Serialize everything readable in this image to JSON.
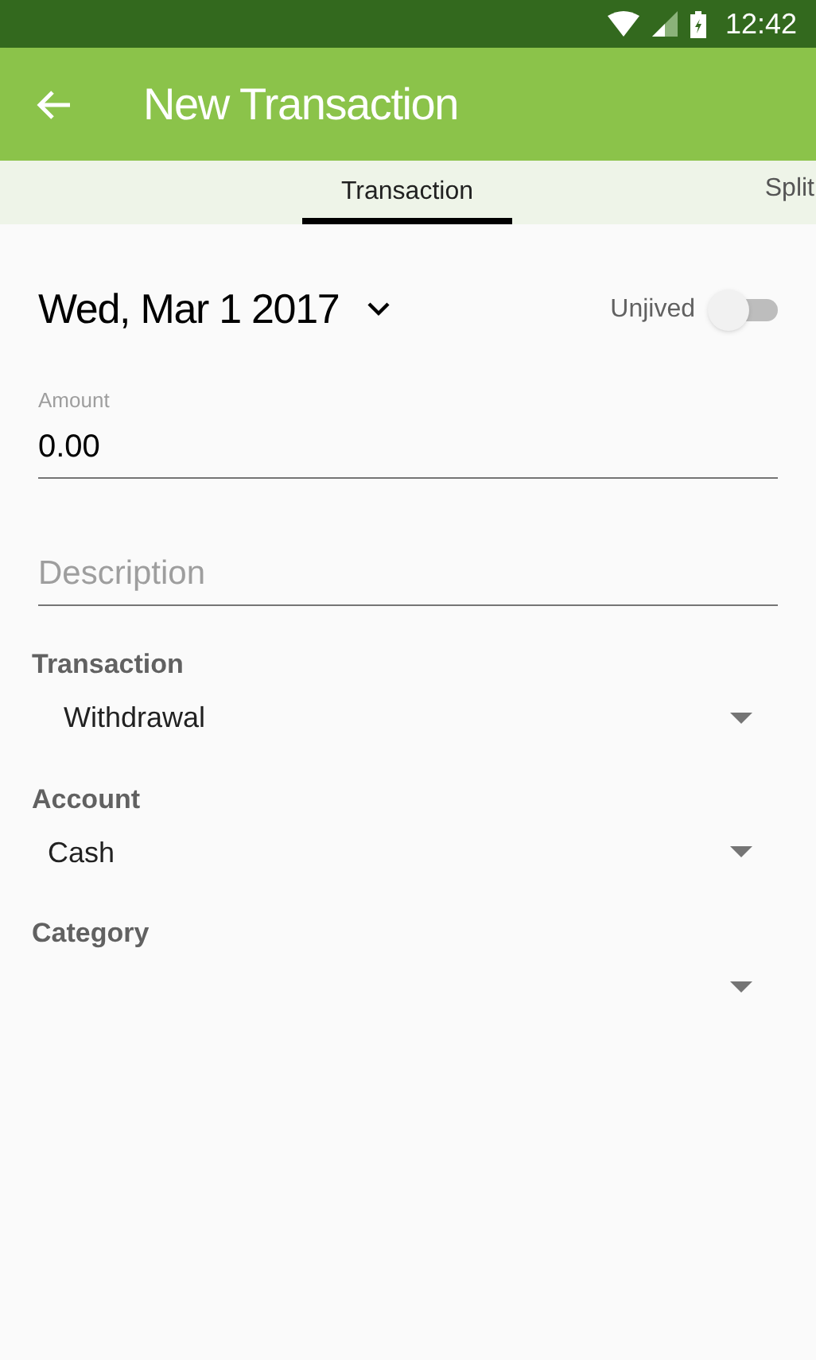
{
  "status_bar": {
    "time": "12:42"
  },
  "app_bar": {
    "title": "New Transaction"
  },
  "tabs": [
    {
      "label": "Transaction",
      "selected": true
    },
    {
      "label": "Split",
      "selected": false
    }
  ],
  "date": "Wed, Mar 1 2017",
  "unjived": {
    "label": "Unjived",
    "on": false
  },
  "amount": {
    "label": "Amount",
    "value": "0.00"
  },
  "description": {
    "placeholder": "Description"
  },
  "selects": [
    {
      "label": "Transaction",
      "value": "Withdrawal"
    },
    {
      "label": "Account",
      "value": "Cash"
    },
    {
      "label": "Category"
    }
  ]
}
